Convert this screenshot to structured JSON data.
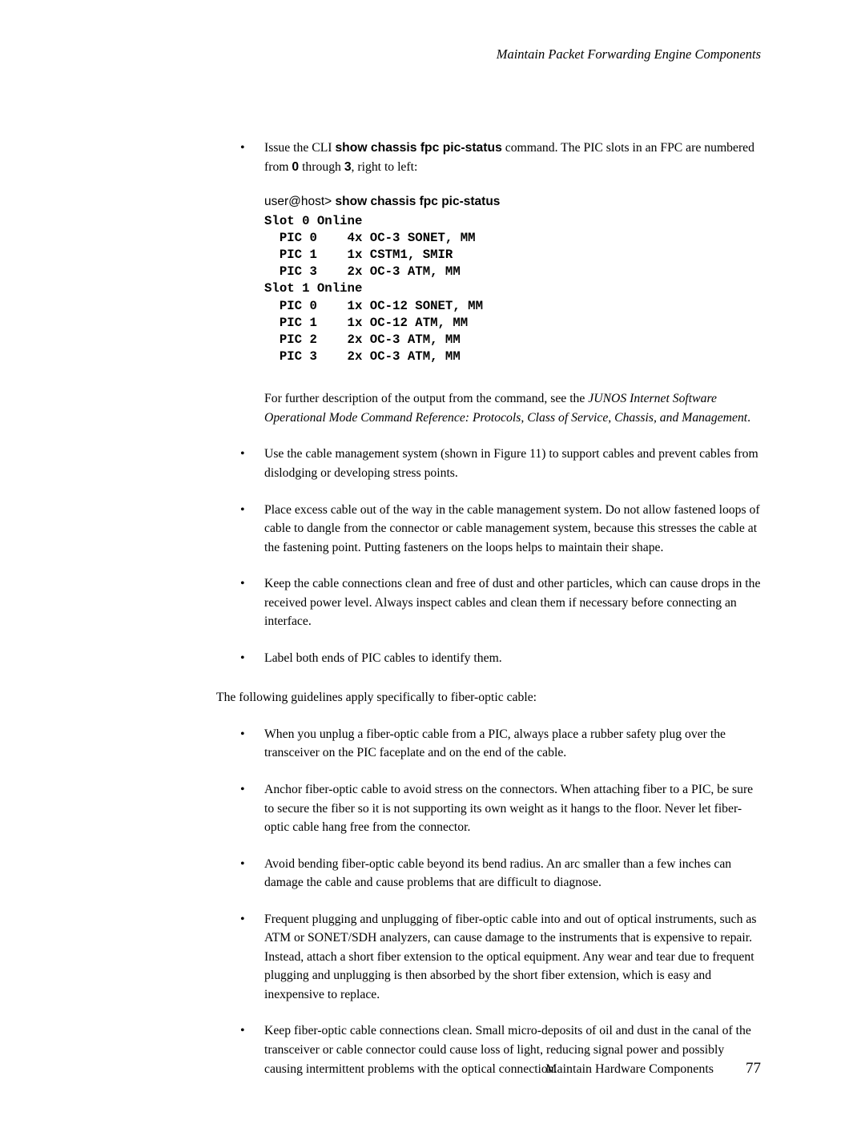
{
  "header": "Maintain Packet Forwarding Engine Components",
  "b1_p1": "Issue the CLI ",
  "b1_cmd": "show chassis fpc pic-status",
  "b1_p2": " command. The PIC slots in an FPC are numbered from ",
  "b1_zero": "0",
  "b1_p3": " through ",
  "b1_three": "3",
  "b1_p4": ", right to left:",
  "userhost": "user@host> ",
  "cmdline": "show chassis fpc pic-status",
  "cli_out": "Slot 0 Online\n  PIC 0    4x OC-3 SONET, MM\n  PIC 1    1x CSTM1, SMIR\n  PIC 3    2x OC-3 ATM, MM\nSlot 1 Online\n  PIC 0    1x OC-12 SONET, MM\n  PIC 1    1x OC-12 ATM, MM\n  PIC 2    2x OC-3 ATM, MM\n  PIC 3    2x OC-3 ATM, MM",
  "desc_p1": "For further description of the output from the command, see the ",
  "desc_it": "JUNOS Internet Software Operational Mode Command Reference: Protocols, Class of Service, Chassis, and Management",
  "desc_p2": ".",
  "b2": "Use the cable management system (shown in Figure 11) to support cables and prevent cables from dislodging or developing stress points.",
  "b3": "Place excess cable out of the way in the cable management system. Do not allow fastened loops of cable to dangle from the connector or cable management system, because this stresses the cable at the fastening point. Putting fasteners on the loops helps to maintain their shape.",
  "b4": "Keep the cable connections clean and free of dust and other particles, which can cause drops in the received power level. Always inspect cables and clean them if necessary before connecting an interface.",
  "b5": "Label both ends of PIC cables to identify them.",
  "fiber_intro": "The following guidelines apply specifically to fiber-optic cable:",
  "f1": "When you unplug a fiber-optic cable from a PIC, always place a rubber safety plug over the transceiver on the PIC faceplate and on the end of the cable.",
  "f2": "Anchor fiber-optic cable to avoid stress on the connectors. When attaching fiber to a PIC, be sure to secure the fiber so it is not supporting its own weight as it hangs to the floor. Never let fiber-optic cable hang free from the connector.",
  "f3": "Avoid bending fiber-optic cable beyond its bend radius. An arc smaller than a few inches can damage the cable and cause problems that are difficult to diagnose.",
  "f4": "Frequent plugging and unplugging of fiber-optic cable into and out of optical instruments, such as ATM or SONET/SDH analyzers, can cause damage to the instruments that is expensive to repair. Instead, attach a short fiber extension to the optical equipment. Any wear and tear due to frequent plugging and unplugging is then absorbed by the short fiber extension, which is easy and inexpensive to replace.",
  "f5": "Keep fiber-optic cable connections clean. Small micro-deposits of oil and dust in the canal of the transceiver or cable connector could cause loss of light, reducing signal power and possibly causing intermittent problems with the optical connection.",
  "footer_text": "Maintain Hardware Components",
  "page_num": "77"
}
